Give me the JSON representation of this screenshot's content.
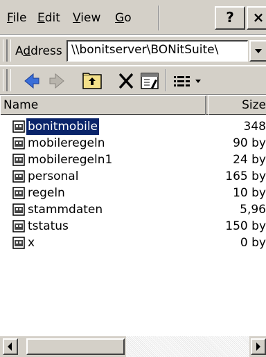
{
  "menu": {
    "file": {
      "accel": "F",
      "rest": "ile"
    },
    "edit": {
      "accel": "E",
      "rest": "dit"
    },
    "view": {
      "accel": "V",
      "rest": "iew"
    },
    "go": {
      "accel": "G",
      "rest": "o"
    },
    "help_label": "?",
    "close_label": "×"
  },
  "address": {
    "label_accel": "d",
    "label_pre": "A",
    "label_post": "dress",
    "value": "\\\\bonitserver\\BONitSuite\\"
  },
  "columns": {
    "name": "Name",
    "size": "Size"
  },
  "files": [
    {
      "name": "bonitmobile",
      "size": "348",
      "selected": true
    },
    {
      "name": "mobileregeln",
      "size": "90 by"
    },
    {
      "name": "mobileregeln1",
      "size": "24 by"
    },
    {
      "name": "personal",
      "size": "165 by"
    },
    {
      "name": "regeln",
      "size": "10 by"
    },
    {
      "name": "stammdaten",
      "size": "5,96"
    },
    {
      "name": "tstatus",
      "size": "150 by"
    },
    {
      "name": "x",
      "size": "0 by"
    }
  ],
  "icons": {
    "back": "back-arrow-icon",
    "forward": "forward-arrow-icon",
    "up": "up-folder-icon",
    "delete": "delete-x-icon",
    "properties": "properties-icon",
    "views": "view-menu-icon",
    "file": "database-file-icon"
  },
  "colors": {
    "chrome": "#d4d0c8",
    "selection": "#0a246a",
    "back_arrow": "#3a6ed8"
  }
}
